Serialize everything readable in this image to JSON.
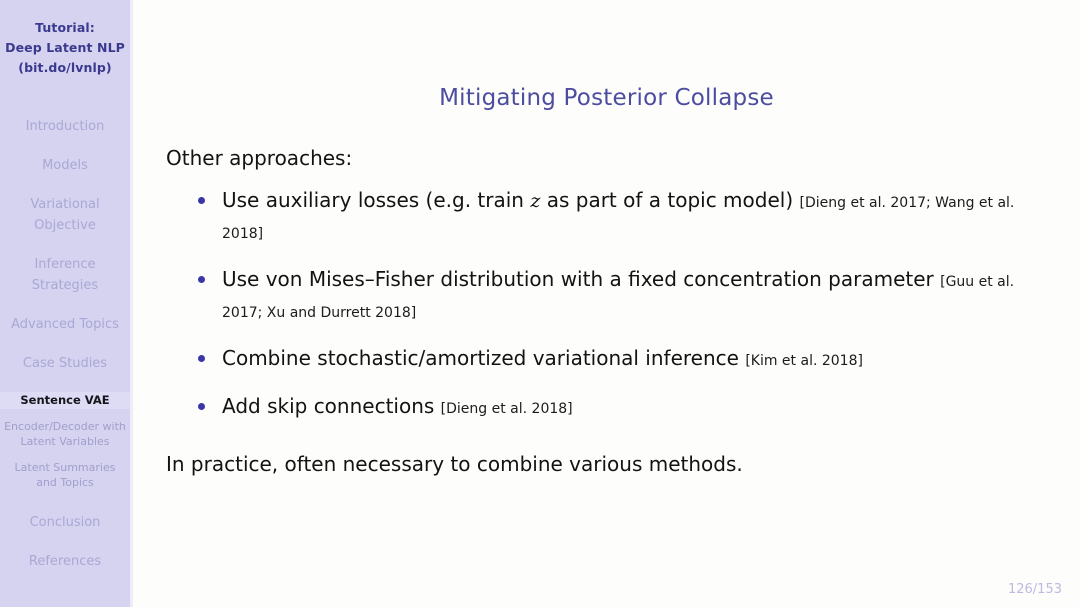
{
  "sidebar": {
    "deck_title_lines": [
      "Tutorial:",
      "Deep Latent NLP",
      "(bit.do/lvnlp)"
    ],
    "sections": [
      {
        "label": "Introduction"
      },
      {
        "label": "Models"
      },
      {
        "label": "Variational Objective"
      },
      {
        "label": "Inference Strategies"
      },
      {
        "label": "Advanced Topics"
      },
      {
        "label": "Case Studies"
      },
      {
        "label": "Conclusion"
      },
      {
        "label": "References"
      }
    ],
    "subsections": [
      {
        "label": "Sentence VAE",
        "current": true
      },
      {
        "label": "Encoder/Decoder with Latent Variables",
        "current": false
      },
      {
        "label": "Latent Summaries and Topics",
        "current": false
      }
    ]
  },
  "slide": {
    "title": "Mitigating Posterior Collapse",
    "lead": "Other approaches:",
    "bullets": [
      {
        "text_before": "Use auxiliary losses (e.g. train ",
        "math": "z",
        "text_after": " as part of a topic model)",
        "citation": "[Dieng et al. 2017; Wang et al. 2018]"
      },
      {
        "text_before": "Use von Mises–Fisher distribution with a fixed concentration parameter",
        "math": "",
        "text_after": "",
        "citation": "[Guu et al. 2017; Xu and Durrett 2018]"
      },
      {
        "text_before": "Combine stochastic/amortized variational inference",
        "math": "",
        "text_after": "",
        "citation": "[Kim et al. 2018]"
      },
      {
        "text_before": "Add skip connections",
        "math": "",
        "text_after": "",
        "citation": "[Dieng et al. 2018]"
      }
    ],
    "closing": "In practice, often necessary to combine various methods.",
    "page_number": "126/153"
  },
  "colors": {
    "sidebar_bg": "#d5d3f0",
    "sidebar_divider": "#edecf8",
    "toc_inactive": "#aaa8d4",
    "title_accent": "#4c4ca0",
    "bullet_dot": "#3b36a8",
    "page_number": "#bcbadf",
    "body_bg": "#fdfdfb"
  }
}
